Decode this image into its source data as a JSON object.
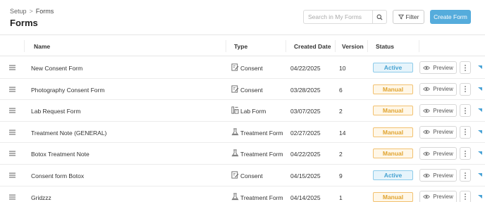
{
  "breadcrumb": {
    "parent": "Setup",
    "separator": ">",
    "current": "Forms"
  },
  "page_title": "Forms",
  "search": {
    "placeholder": "Search in My Forms",
    "value": ""
  },
  "toolbar": {
    "filter_label": "Filter",
    "create_label": "Create Form"
  },
  "columns": {
    "name": "Name",
    "type": "Type",
    "created_date": "Created Date",
    "version": "Version",
    "status": "Status"
  },
  "preview_label": "Preview",
  "colors": {
    "accent": "#55acdc",
    "active": "#45a2d1",
    "manual": "#e0a32f"
  },
  "rows": [
    {
      "name": "New Consent Form",
      "type": "Consent",
      "type_icon": "consent-icon",
      "created": "04/22/2025",
      "version": "10",
      "status": "Active"
    },
    {
      "name": "Photography Consent Form",
      "type": "Consent",
      "type_icon": "consent-icon",
      "created": "03/28/2025",
      "version": "6",
      "status": "Manual"
    },
    {
      "name": "Lab Request Form",
      "type": "Lab Form",
      "type_icon": "lab-form-icon",
      "created": "03/07/2025",
      "version": "2",
      "status": "Manual"
    },
    {
      "name": "Treatment Note (GENERAL)",
      "type": "Treatment Form",
      "type_icon": "treatment-form-icon",
      "created": "02/27/2025",
      "version": "14",
      "status": "Manual"
    },
    {
      "name": "Botox Treatment Note",
      "type": "Treatment Form",
      "type_icon": "treatment-form-icon",
      "created": "04/22/2025",
      "version": "2",
      "status": "Manual"
    },
    {
      "name": "Consent form Botox",
      "type": "Consent",
      "type_icon": "consent-icon",
      "created": "04/15/2025",
      "version": "9",
      "status": "Active"
    },
    {
      "name": "Gridzzz",
      "type": "Treatment Form",
      "type_icon": "treatment-form-icon",
      "created": "04/14/2025",
      "version": "1",
      "status": "Manual"
    }
  ]
}
